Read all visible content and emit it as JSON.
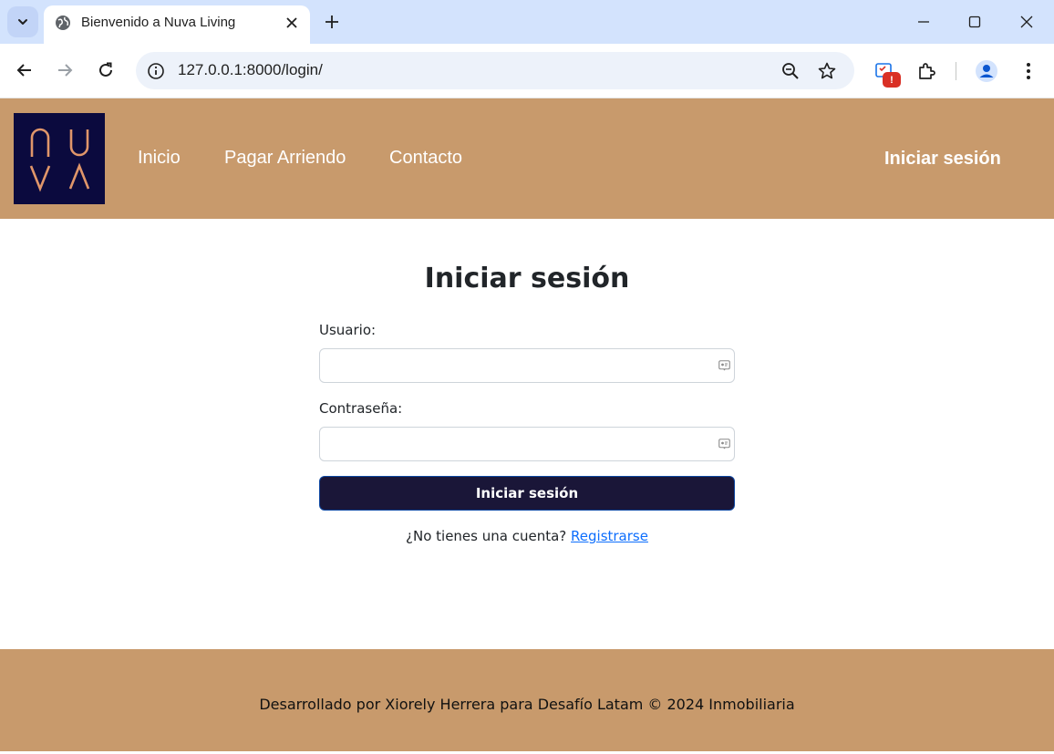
{
  "browser": {
    "tab_title": "Bienvenido a Nuva Living",
    "url": "127.0.0.1:8000/login/",
    "notification_badge": "!"
  },
  "site": {
    "logo_text": "NUVA",
    "nav": [
      "Inicio",
      "Pagar Arriendo",
      "Contacto"
    ],
    "login_link": "Iniciar sesión"
  },
  "login": {
    "title": "Iniciar sesión",
    "username_label": "Usuario:",
    "username_value": "",
    "password_label": "Contraseña:",
    "password_value": "",
    "submit_label": "Iniciar sesión",
    "no_account_text": "¿No tienes una cuenta?",
    "register_link": "Registrarse"
  },
  "footer": {
    "text": "Desarrollado por Xiorely Herrera para Desafío Latam © 2024 Inmobiliaria"
  },
  "colors": {
    "header_bg": "#c89a6c",
    "logo_bg": "#0b0a3e",
    "logo_stroke": "#e0966a",
    "button_bg": "#1a1638",
    "link": "#0d6efd"
  },
  "icons": [
    "tab-search-icon",
    "globe-icon",
    "close-icon",
    "plus-icon",
    "minimize-icon",
    "maximize-icon",
    "window-close-icon",
    "back-arrow-icon",
    "forward-arrow-icon",
    "reload-icon",
    "info-icon",
    "zoom-icon",
    "star-icon",
    "extension-alert-icon",
    "puzzle-icon",
    "profile-icon",
    "kebab-menu-icon",
    "key-icon"
  ]
}
